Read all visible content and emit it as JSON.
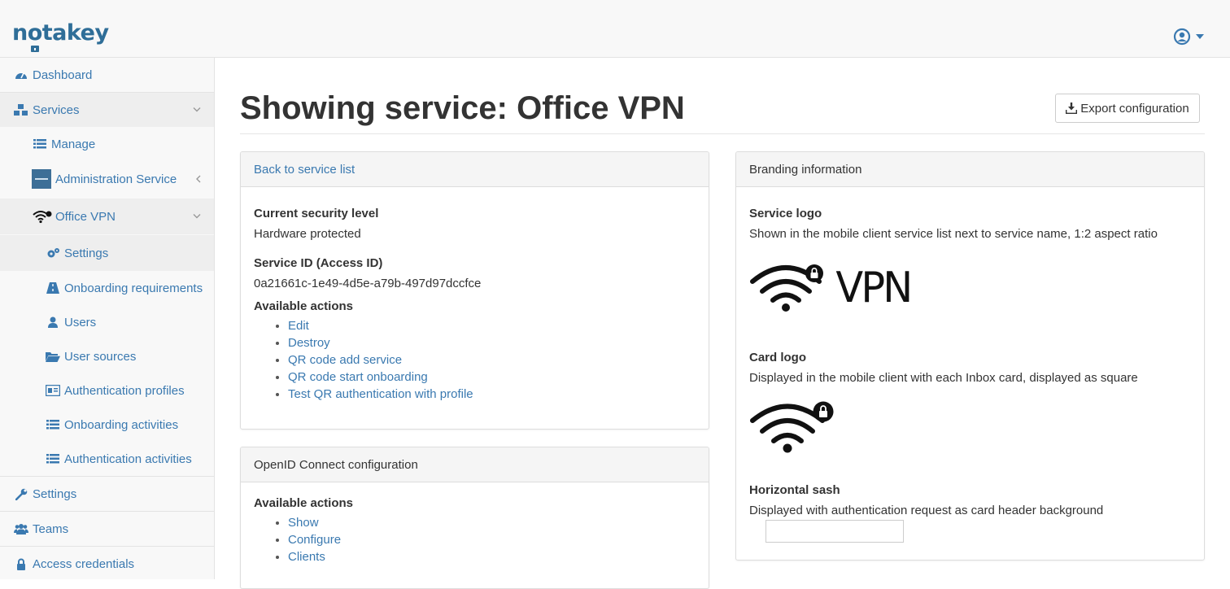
{
  "brand": {
    "name": "notakey"
  },
  "sidebar": {
    "dashboard": "Dashboard",
    "services": "Services",
    "manage": "Manage",
    "admin_service": "Administration Service",
    "office_vpn": "Office VPN",
    "settings_sub": "Settings",
    "onboarding_requirements": "Onboarding requirements",
    "users": "Users",
    "user_sources": "User sources",
    "authentication_profiles": "Authentication profiles",
    "onboarding_activities": "Onboarding activities",
    "authentication_activities": "Authentication activities",
    "settings": "Settings",
    "teams": "Teams",
    "access_credentials": "Access credentials"
  },
  "main": {
    "title": "Showing service: Office VPN",
    "export_button": "Export configuration",
    "service_panel": {
      "header_link": "Back to service list",
      "security_label": "Current security level",
      "security_value": "Hardware protected",
      "service_id_label": "Service ID (Access ID)",
      "service_id_value": "0a21661c-1e49-4d5e-a79b-497d97dccfce",
      "actions_label": "Available actions",
      "actions": [
        "Edit",
        "Destroy",
        "QR code add service",
        "QR code start onboarding",
        "Test QR authentication with profile"
      ]
    },
    "openid_panel": {
      "header": "OpenID Connect configuration",
      "actions_label": "Available actions",
      "actions": [
        "Show",
        "Configure",
        "Clients"
      ]
    },
    "branding_panel": {
      "header": "Branding information",
      "service_logo_label": "Service logo",
      "service_logo_desc": "Shown in the mobile client service list next to service name, 1:2 aspect ratio",
      "service_logo_text": "VPN",
      "card_logo_label": "Card logo",
      "card_logo_desc": "Displayed in the mobile client with each Inbox card, displayed as square",
      "sash_label": "Horizontal sash",
      "sash_desc": "Displayed with authentication request as card header background"
    }
  },
  "colors": {
    "link": "#3a79b0",
    "brand": "#2f6e98",
    "sidebar_bg": "#f8f8f8",
    "active_bg": "#eeeeee"
  }
}
